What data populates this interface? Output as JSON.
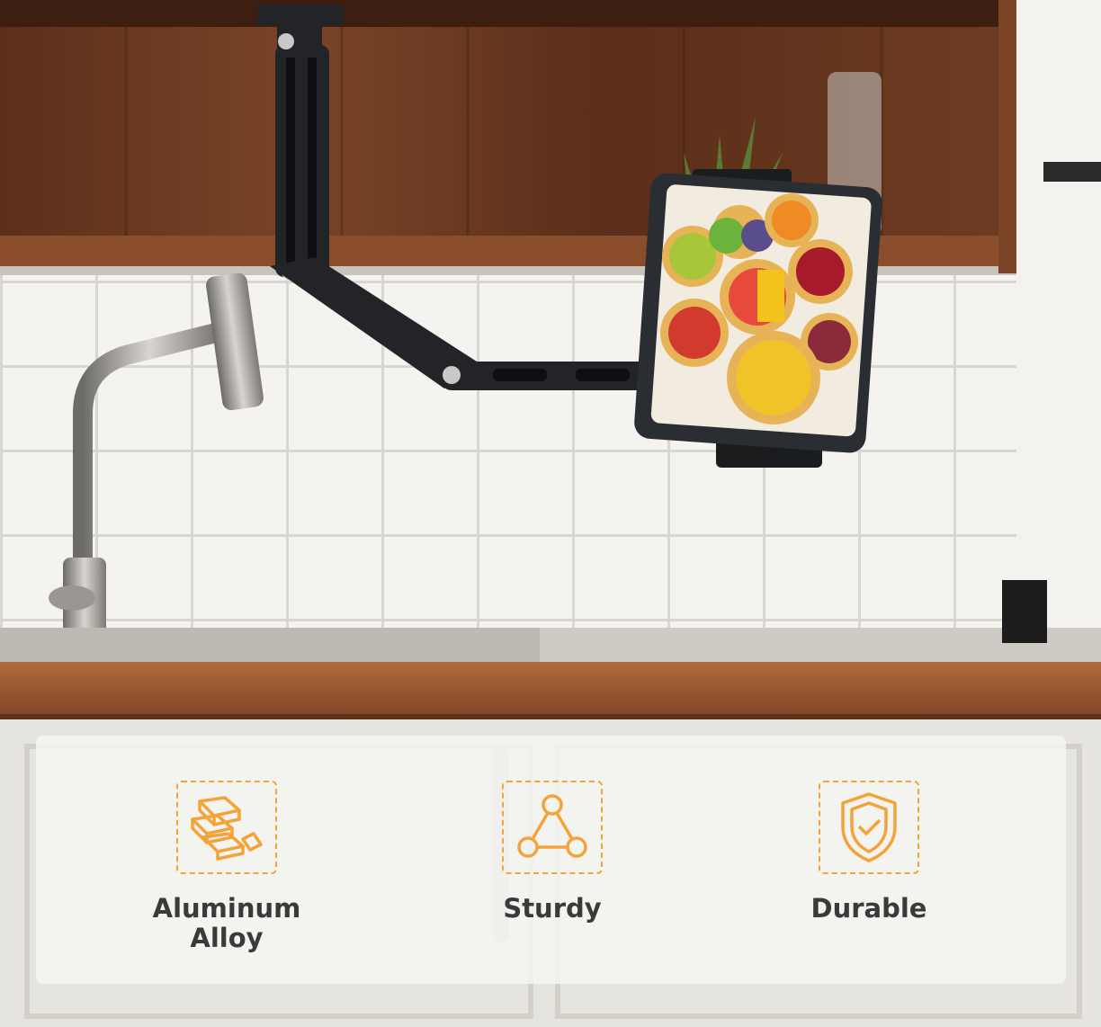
{
  "colors": {
    "accent": "#f3a33a",
    "wood": "#6b3b22",
    "counter": "#9a5a33",
    "tile": "#f2f1ee",
    "mount": "#1f2124",
    "text": "#3a3a3a"
  },
  "scene": {
    "image_subject": "ceiling-mounted tablet holder arm in a kitchen"
  },
  "features": [
    {
      "icon": "gold-bars-icon",
      "label": "Aluminum\nAlloy"
    },
    {
      "icon": "triangle-nodes-icon",
      "label": "Sturdy"
    },
    {
      "icon": "shield-check-icon",
      "label": "Durable"
    }
  ]
}
